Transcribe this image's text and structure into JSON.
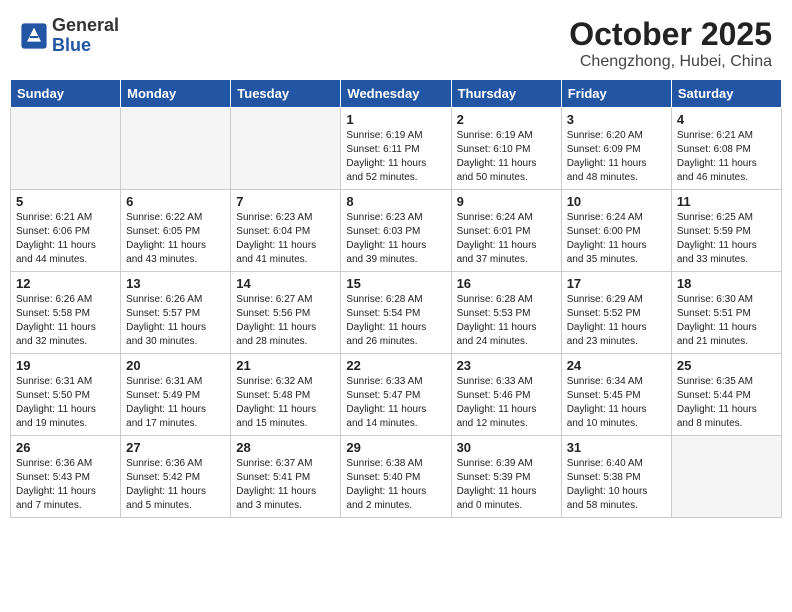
{
  "header": {
    "logo_general": "General",
    "logo_blue": "Blue",
    "month": "October 2025",
    "location": "Chengzhong, Hubei, China"
  },
  "weekdays": [
    "Sunday",
    "Monday",
    "Tuesday",
    "Wednesday",
    "Thursday",
    "Friday",
    "Saturday"
  ],
  "weeks": [
    [
      {
        "day": "",
        "info": ""
      },
      {
        "day": "",
        "info": ""
      },
      {
        "day": "",
        "info": ""
      },
      {
        "day": "1",
        "info": "Sunrise: 6:19 AM\nSunset: 6:11 PM\nDaylight: 11 hours\nand 52 minutes."
      },
      {
        "day": "2",
        "info": "Sunrise: 6:19 AM\nSunset: 6:10 PM\nDaylight: 11 hours\nand 50 minutes."
      },
      {
        "day": "3",
        "info": "Sunrise: 6:20 AM\nSunset: 6:09 PM\nDaylight: 11 hours\nand 48 minutes."
      },
      {
        "day": "4",
        "info": "Sunrise: 6:21 AM\nSunset: 6:08 PM\nDaylight: 11 hours\nand 46 minutes."
      }
    ],
    [
      {
        "day": "5",
        "info": "Sunrise: 6:21 AM\nSunset: 6:06 PM\nDaylight: 11 hours\nand 44 minutes."
      },
      {
        "day": "6",
        "info": "Sunrise: 6:22 AM\nSunset: 6:05 PM\nDaylight: 11 hours\nand 43 minutes."
      },
      {
        "day": "7",
        "info": "Sunrise: 6:23 AM\nSunset: 6:04 PM\nDaylight: 11 hours\nand 41 minutes."
      },
      {
        "day": "8",
        "info": "Sunrise: 6:23 AM\nSunset: 6:03 PM\nDaylight: 11 hours\nand 39 minutes."
      },
      {
        "day": "9",
        "info": "Sunrise: 6:24 AM\nSunset: 6:01 PM\nDaylight: 11 hours\nand 37 minutes."
      },
      {
        "day": "10",
        "info": "Sunrise: 6:24 AM\nSunset: 6:00 PM\nDaylight: 11 hours\nand 35 minutes."
      },
      {
        "day": "11",
        "info": "Sunrise: 6:25 AM\nSunset: 5:59 PM\nDaylight: 11 hours\nand 33 minutes."
      }
    ],
    [
      {
        "day": "12",
        "info": "Sunrise: 6:26 AM\nSunset: 5:58 PM\nDaylight: 11 hours\nand 32 minutes."
      },
      {
        "day": "13",
        "info": "Sunrise: 6:26 AM\nSunset: 5:57 PM\nDaylight: 11 hours\nand 30 minutes."
      },
      {
        "day": "14",
        "info": "Sunrise: 6:27 AM\nSunset: 5:56 PM\nDaylight: 11 hours\nand 28 minutes."
      },
      {
        "day": "15",
        "info": "Sunrise: 6:28 AM\nSunset: 5:54 PM\nDaylight: 11 hours\nand 26 minutes."
      },
      {
        "day": "16",
        "info": "Sunrise: 6:28 AM\nSunset: 5:53 PM\nDaylight: 11 hours\nand 24 minutes."
      },
      {
        "day": "17",
        "info": "Sunrise: 6:29 AM\nSunset: 5:52 PM\nDaylight: 11 hours\nand 23 minutes."
      },
      {
        "day": "18",
        "info": "Sunrise: 6:30 AM\nSunset: 5:51 PM\nDaylight: 11 hours\nand 21 minutes."
      }
    ],
    [
      {
        "day": "19",
        "info": "Sunrise: 6:31 AM\nSunset: 5:50 PM\nDaylight: 11 hours\nand 19 minutes."
      },
      {
        "day": "20",
        "info": "Sunrise: 6:31 AM\nSunset: 5:49 PM\nDaylight: 11 hours\nand 17 minutes."
      },
      {
        "day": "21",
        "info": "Sunrise: 6:32 AM\nSunset: 5:48 PM\nDaylight: 11 hours\nand 15 minutes."
      },
      {
        "day": "22",
        "info": "Sunrise: 6:33 AM\nSunset: 5:47 PM\nDaylight: 11 hours\nand 14 minutes."
      },
      {
        "day": "23",
        "info": "Sunrise: 6:33 AM\nSunset: 5:46 PM\nDaylight: 11 hours\nand 12 minutes."
      },
      {
        "day": "24",
        "info": "Sunrise: 6:34 AM\nSunset: 5:45 PM\nDaylight: 11 hours\nand 10 minutes."
      },
      {
        "day": "25",
        "info": "Sunrise: 6:35 AM\nSunset: 5:44 PM\nDaylight: 11 hours\nand 8 minutes."
      }
    ],
    [
      {
        "day": "26",
        "info": "Sunrise: 6:36 AM\nSunset: 5:43 PM\nDaylight: 11 hours\nand 7 minutes."
      },
      {
        "day": "27",
        "info": "Sunrise: 6:36 AM\nSunset: 5:42 PM\nDaylight: 11 hours\nand 5 minutes."
      },
      {
        "day": "28",
        "info": "Sunrise: 6:37 AM\nSunset: 5:41 PM\nDaylight: 11 hours\nand 3 minutes."
      },
      {
        "day": "29",
        "info": "Sunrise: 6:38 AM\nSunset: 5:40 PM\nDaylight: 11 hours\nand 2 minutes."
      },
      {
        "day": "30",
        "info": "Sunrise: 6:39 AM\nSunset: 5:39 PM\nDaylight: 11 hours\nand 0 minutes."
      },
      {
        "day": "31",
        "info": "Sunrise: 6:40 AM\nSunset: 5:38 PM\nDaylight: 10 hours\nand 58 minutes."
      },
      {
        "day": "",
        "info": ""
      }
    ]
  ]
}
